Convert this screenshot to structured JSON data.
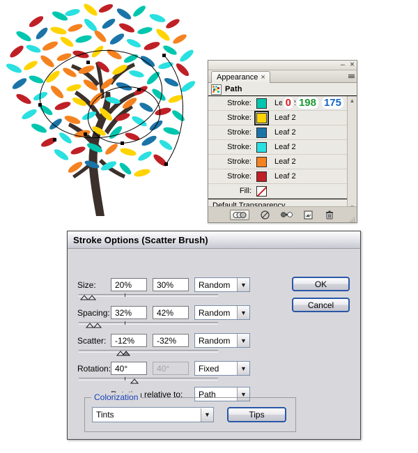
{
  "artwork": {
    "name": "scatter-brush-tree-illustration",
    "description": "Stylized tree with multicolored leaves drawn with a scatter brush, with selected spiral paths visible",
    "trunk_color": "#3b302b",
    "leaf_colors": [
      "#00c6af",
      "#ffd400",
      "#1b74a8",
      "#2ae0e0",
      "#f58220",
      "#bf2026"
    ],
    "path_stroke_color": "#000000",
    "anchor_point_color": "#000000"
  },
  "appearance_panel": {
    "window": {
      "minimize_label": "–",
      "close_label": "×"
    },
    "tab": {
      "label": "Appearance",
      "close_label": "×"
    },
    "menu_label": "panel-menu",
    "header": {
      "label": "Path",
      "thumbnail_name": "path-thumbnail"
    },
    "rgb_badge": {
      "r": "0",
      "g": "198",
      "b": "175",
      "r_color": "#e01b1b",
      "g_color": "#1f9b35",
      "b_color": "#1566c4"
    },
    "rows": [
      {
        "label": "Stroke:",
        "value": "Leaf 2",
        "color": "#00c6af",
        "selected": false
      },
      {
        "label": "Stroke:",
        "value": "Leaf 2",
        "color": "#ffd400",
        "selected": true
      },
      {
        "label": "Stroke:",
        "value": "Leaf 2",
        "color": "#1b74a8",
        "selected": false
      },
      {
        "label": "Stroke:",
        "value": "Leaf 2",
        "color": "#2ae0e0",
        "selected": false
      },
      {
        "label": "Stroke:",
        "value": "Leaf 2",
        "color": "#f58220",
        "selected": false
      },
      {
        "label": "Stroke:",
        "value": "Leaf 2",
        "color": "#bf2026",
        "selected": false
      }
    ],
    "fill_row": {
      "label": "Fill:",
      "value": "",
      "color": "none"
    },
    "transparency_row": {
      "label": "Default Transparency"
    },
    "scrollbar": {
      "up_label": "▲",
      "down_label": "▼"
    },
    "footer_buttons": [
      {
        "name": "new-art-has-basic-appearance-button"
      },
      {
        "name": "clear-appearance-button"
      },
      {
        "name": "reduce-to-basic-appearance-button"
      },
      {
        "name": "duplicate-selected-item-button"
      },
      {
        "name": "delete-selected-item-button"
      }
    ]
  },
  "stroke_dialog": {
    "title": "Stroke Options (Scatter Brush)",
    "fields": [
      {
        "label": "Size:",
        "min_value": "20%",
        "max_value": "30%",
        "mode": "Random",
        "mode_disabled": false,
        "max_disabled": false
      },
      {
        "label": "Spacing:",
        "min_value": "32%",
        "max_value": "42%",
        "mode": "Random",
        "mode_disabled": false,
        "max_disabled": false
      },
      {
        "label": "Scatter:",
        "min_value": "-12%",
        "max_value": "-32%",
        "mode": "Random",
        "mode_disabled": false,
        "max_disabled": false
      },
      {
        "label": "Rotation:",
        "min_value": "40°",
        "max_value": "40°",
        "mode": "Fixed",
        "mode_disabled": false,
        "max_disabled": true
      }
    ],
    "rotation_relative": {
      "label": "Rotation relative to:",
      "value": "Path"
    },
    "colorization": {
      "title": "Colorization",
      "title_color": "#1b3fb5",
      "method": "Tints",
      "tips_label": "Tips"
    },
    "ok_label": "OK",
    "cancel_label": "Cancel",
    "dropdown_arrow": "▼"
  }
}
